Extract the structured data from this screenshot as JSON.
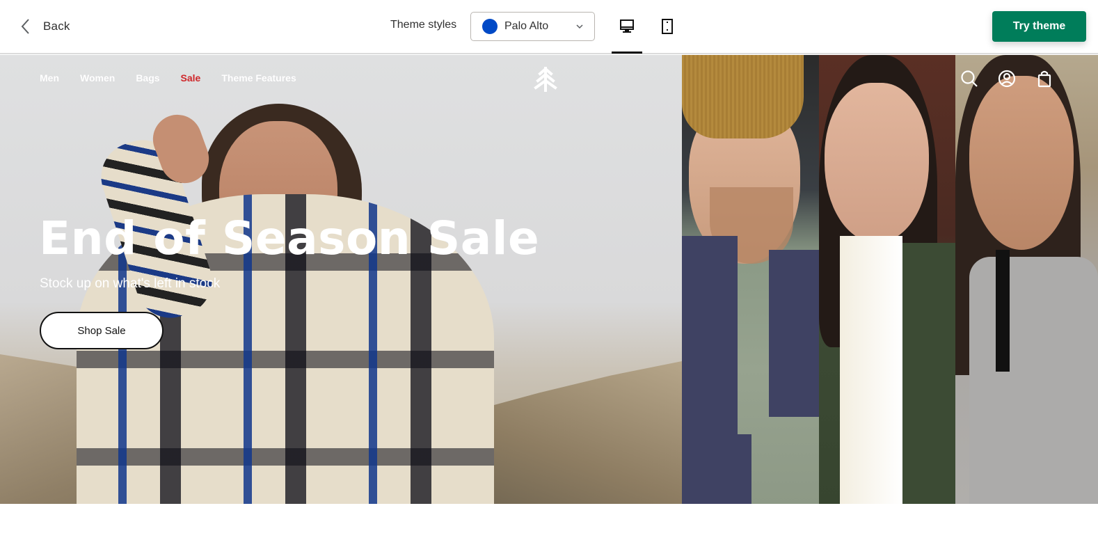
{
  "toolbar": {
    "back_label": "Back",
    "theme_styles_label": "Theme styles",
    "theme_select": {
      "selected": "Palo Alto",
      "swatch_color": "#0049c6"
    },
    "device_views": [
      {
        "name": "desktop",
        "active": true
      },
      {
        "name": "mobile",
        "active": false
      }
    ],
    "try_theme_label": "Try theme",
    "try_theme_color": "#007d5a"
  },
  "store": {
    "nav": [
      {
        "label": "Men"
      },
      {
        "label": "Women"
      },
      {
        "label": "Bags"
      },
      {
        "label": "Sale",
        "color": "#d0282b"
      },
      {
        "label": "Theme Features"
      }
    ],
    "logo": "tree-logo",
    "header_icons": [
      "search-icon",
      "account-icon",
      "cart-icon"
    ]
  },
  "hero": {
    "title": "End of Season Sale",
    "subtitle": "Stock up on what's left in stock",
    "cta_label": "Shop Sale"
  }
}
